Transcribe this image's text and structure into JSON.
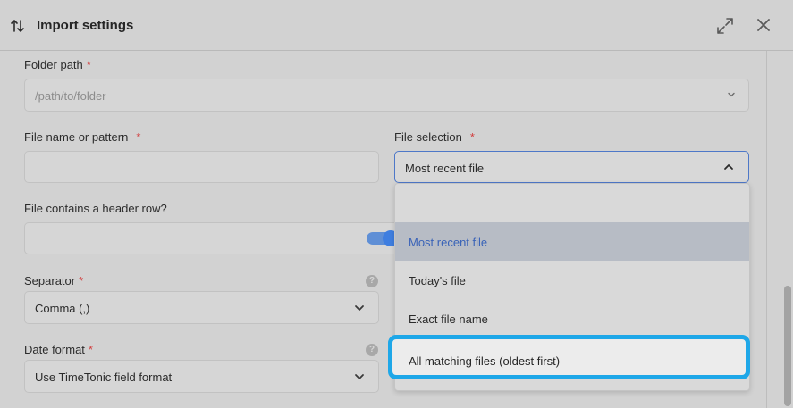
{
  "dialog": {
    "title": "Import settings"
  },
  "form": {
    "folder_path": {
      "label": "Folder path",
      "required_mark": "*",
      "placeholder": "/path/to/folder"
    },
    "file_name": {
      "label": "File name or pattern",
      "required_mark": "*",
      "value": ""
    },
    "file_selection": {
      "label": "File selection",
      "required_mark": "*",
      "value": "Most recent file",
      "options": [
        "Most recent file",
        "Today's file",
        "Exact file name",
        "All matching files (oldest first)"
      ]
    },
    "header_row": {
      "label": "File contains a header row?",
      "enabled": true
    },
    "separator": {
      "label": "Separator",
      "required_mark": "*",
      "value": "Comma (,)",
      "help": "?"
    },
    "date_format": {
      "label": "Date format",
      "required_mark": "*",
      "value": "Use TimeTonic field format",
      "help": "?"
    }
  },
  "colors": {
    "accent": "#3f7ee0",
    "highlight_border": "#1ea7e8",
    "required": "#d23c3c"
  },
  "icons": {
    "title": "sort-arrows-icon",
    "expand": "expand-icon",
    "close": "close-icon"
  }
}
